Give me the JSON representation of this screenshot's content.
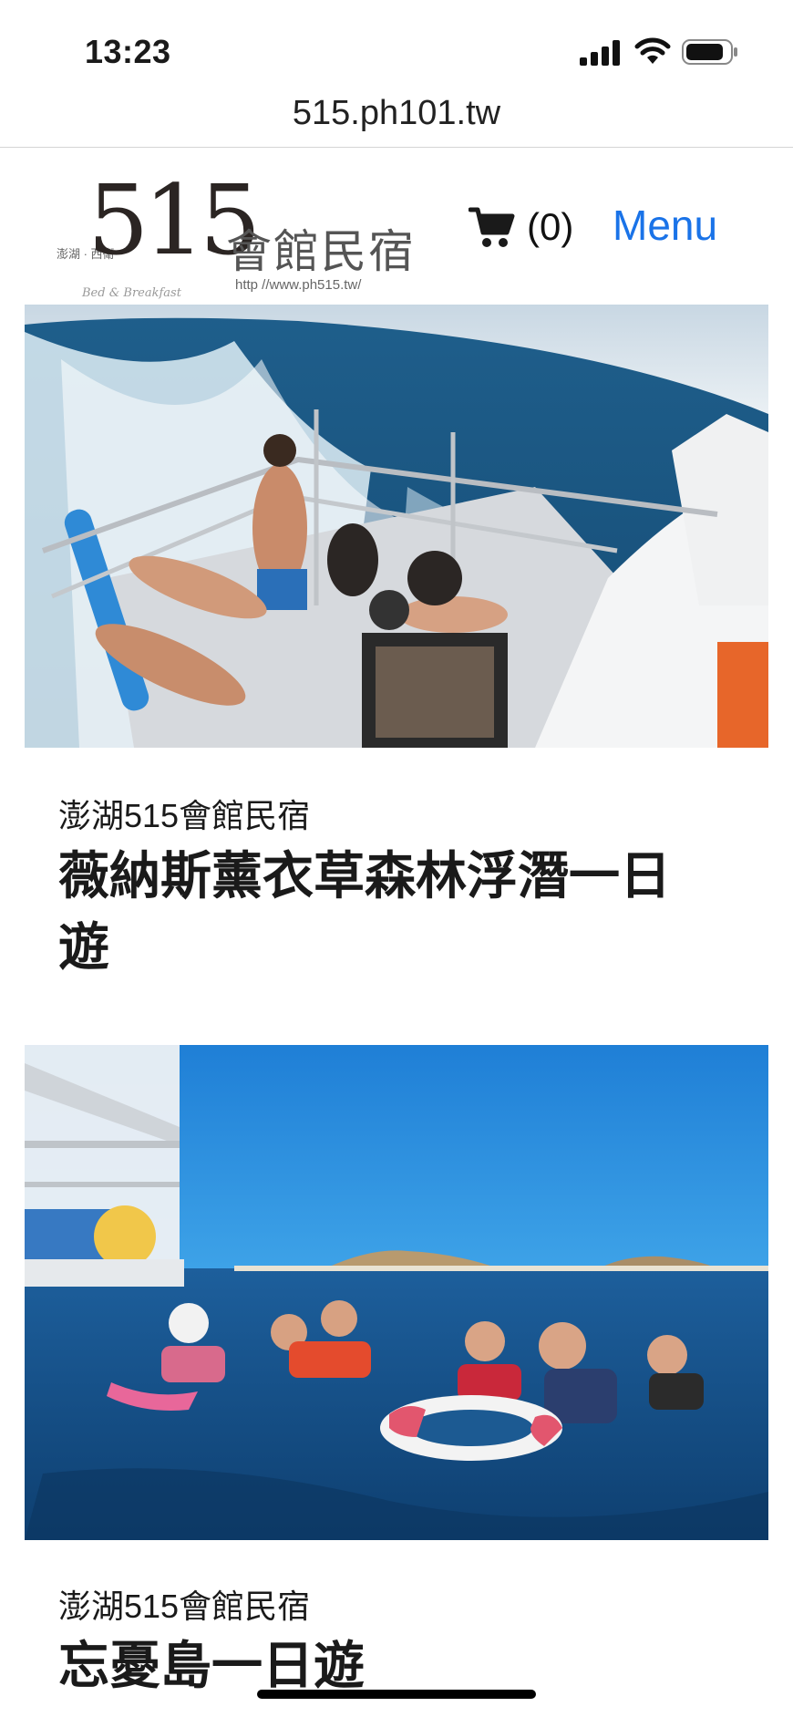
{
  "status_bar": {
    "time": "13:23"
  },
  "browser": {
    "url": "515.ph101.tw"
  },
  "header": {
    "logo": {
      "number": "515",
      "name": "會館民宿",
      "location": "澎湖 · 西衛",
      "url": "http //www.ph515.tw/",
      "tagline": "Bed & Breakfast"
    },
    "cart_count": "(0)",
    "menu_label": "Menu"
  },
  "cards": [
    {
      "subtitle": "澎湖515會館民宿",
      "title": "薇納斯薰衣草森林浮潛一日遊"
    },
    {
      "subtitle": "澎湖515會館民宿",
      "title": "忘憂島一日遊"
    }
  ],
  "colors": {
    "link": "#1a73e8",
    "text": "#1a1a1a"
  }
}
